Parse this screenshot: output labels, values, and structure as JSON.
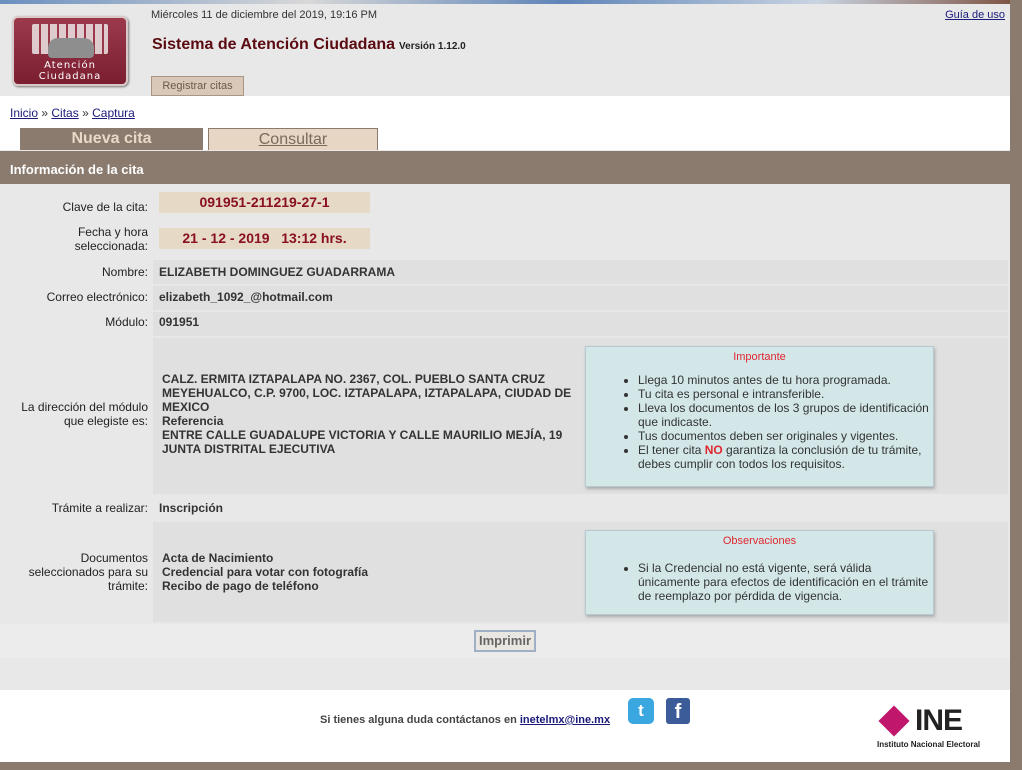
{
  "header": {
    "date": "Miércoles 11 de diciembre del 2019, 19:16 PM",
    "guide_link": "Guía de uso",
    "title": "Sistema de Atención Ciudadana",
    "version": "Versión 1.12.0",
    "logo_line1": "Atención",
    "logo_line2": "Ciudadana",
    "register_button": "Registrar citas"
  },
  "breadcrumb": {
    "home": "Inicio",
    "sep1": "»",
    "citas": "Citas",
    "sep2": "»",
    "captura": "Captura"
  },
  "tabs": {
    "new": "Nueva cita",
    "consult": "Consultar"
  },
  "section_title": "Información de la cita",
  "fields": {
    "clave_label": "Clave de la cita:",
    "clave_value": "091951-211219-27-1",
    "fecha_label_1": "Fecha y hora",
    "fecha_label_2": "seleccionada:",
    "fecha_value": "21 - 12 - 2019   13:12 hrs.",
    "nombre_label": "Nombre:",
    "nombre_value": "ELIZABETH DOMINGUEZ GUADARRAMA",
    "correo_label": "Correo electrónico:",
    "correo_value": "elizabeth_1092_@hotmail.com",
    "modulo_label": "Módulo:",
    "modulo_value": "091951",
    "direccion_label_1": "La dirección del módulo",
    "direccion_label_2": "que elegiste es:",
    "direccion_lines": [
      "CALZ. ERMITA IZTAPALAPA NO. 2367, COL. PUEBLO SANTA CRUZ",
      "MEYEHUALCO, C.P. 9700, LOC. IZTAPALAPA, IZTAPALAPA, CIUDAD DE",
      "MEXICO",
      "Referencia",
      "ENTRE CALLE GUADALUPE VICTORIA Y CALLE MAURILIO MEJÍA, 19",
      "JUNTA DISTRITAL EJECUTIVA"
    ],
    "tramite_label": "Trámite a realizar:",
    "tramite_value": "Inscripción",
    "docs_label_1": "Documentos",
    "docs_label_2": "seleccionados para su",
    "docs_label_3": "trámite:",
    "docs": [
      "Acta de Nacimiento",
      "Credencial para votar con fotografía",
      "Recibo de pago de teléfono"
    ]
  },
  "importante": {
    "title": "Importante",
    "items": [
      "Llega 10 minutos antes de tu hora programada.",
      "Tu cita es personal e intransferible.",
      "Lleva los documentos de los 3 grupos de identificación que indicaste.",
      "Tus documentos deben ser originales y vigentes."
    ],
    "last_pre": "El tener cita ",
    "last_no": "NO",
    "last_post": " garantiza la conclusión de tu trámite, debes cumplir con todos los requisitos."
  },
  "observaciones": {
    "title": "Observaciones",
    "items": [
      "Si la Credencial no está vigente, será válida únicamente para efectos de identificación en el trámite de reemplazo por pérdida de vigencia."
    ]
  },
  "print_button": "Imprimir",
  "footer": {
    "contact_text": "Si tienes alguna duda contáctanos en ",
    "contact_email": "inetelmx@ine.mx",
    "twitter_glyph": "t",
    "facebook_glyph": "f",
    "ine_logo": "INE",
    "ine_sub": "Instituto Nacional Electoral"
  }
}
